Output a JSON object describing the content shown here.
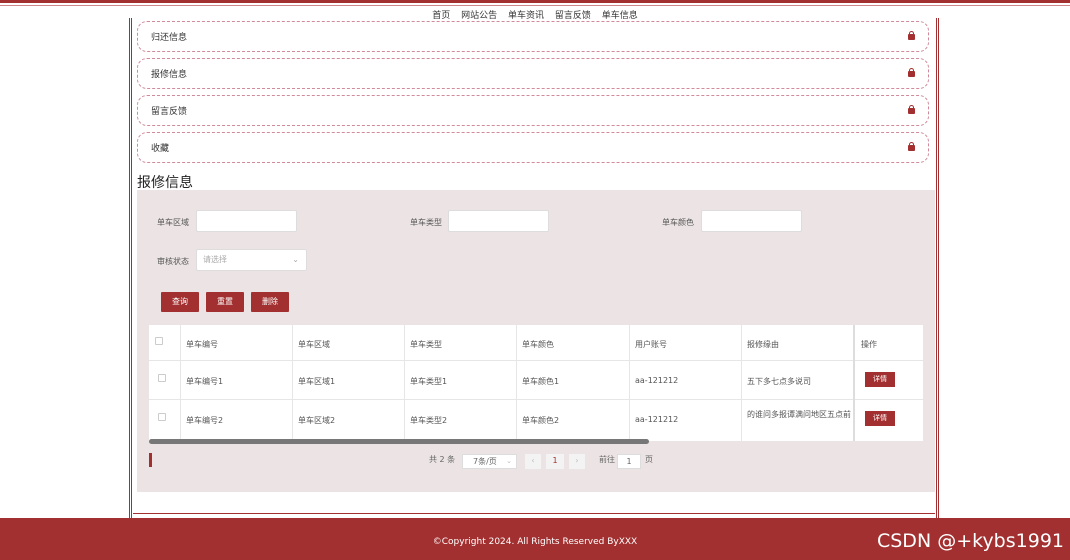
{
  "nav": [
    "首页",
    "网站公告",
    "单车资讯",
    "留言反馈",
    "单车信息"
  ],
  "accordion": [
    "归还信息",
    "报修信息",
    "留言反馈",
    "收藏"
  ],
  "section_title": "报修信息",
  "filters": {
    "area_label": "单车区域",
    "type_label": "单车类型",
    "color_label": "单车颜色",
    "status_label": "审核状态",
    "status_placeholder": "请选择"
  },
  "buttons": {
    "search": "查询",
    "reset": "重置",
    "delete": "删除"
  },
  "table": {
    "headers": [
      "单车编号",
      "单车区域",
      "单车类型",
      "单车颜色",
      "用户账号",
      "报修缘由",
      "操作"
    ],
    "rows": [
      {
        "num": "单车编号1",
        "area": "单车区域1",
        "type": "单车类型1",
        "color": "单车颜色1",
        "account": "aa-121212",
        "reason": "五下多七点多说司",
        "action": "详情"
      },
      {
        "num": "单车编号2",
        "area": "单车区域2",
        "type": "单车类型2",
        "color": "单车颜色2",
        "account": "aa-121212",
        "reason": "的谁问多报谭满问地区五点前",
        "action": "详情"
      }
    ]
  },
  "pagination": {
    "total": "共 2 条",
    "page_size": "7条/页",
    "current": "1",
    "goto_prefix": "前往",
    "goto_value": "1",
    "goto_suffix": "页"
  },
  "footer": {
    "copyright": "©Copyright 2024. All Rights Reserved ByXXX",
    "watermark": "CSDN @+kybs1991"
  }
}
